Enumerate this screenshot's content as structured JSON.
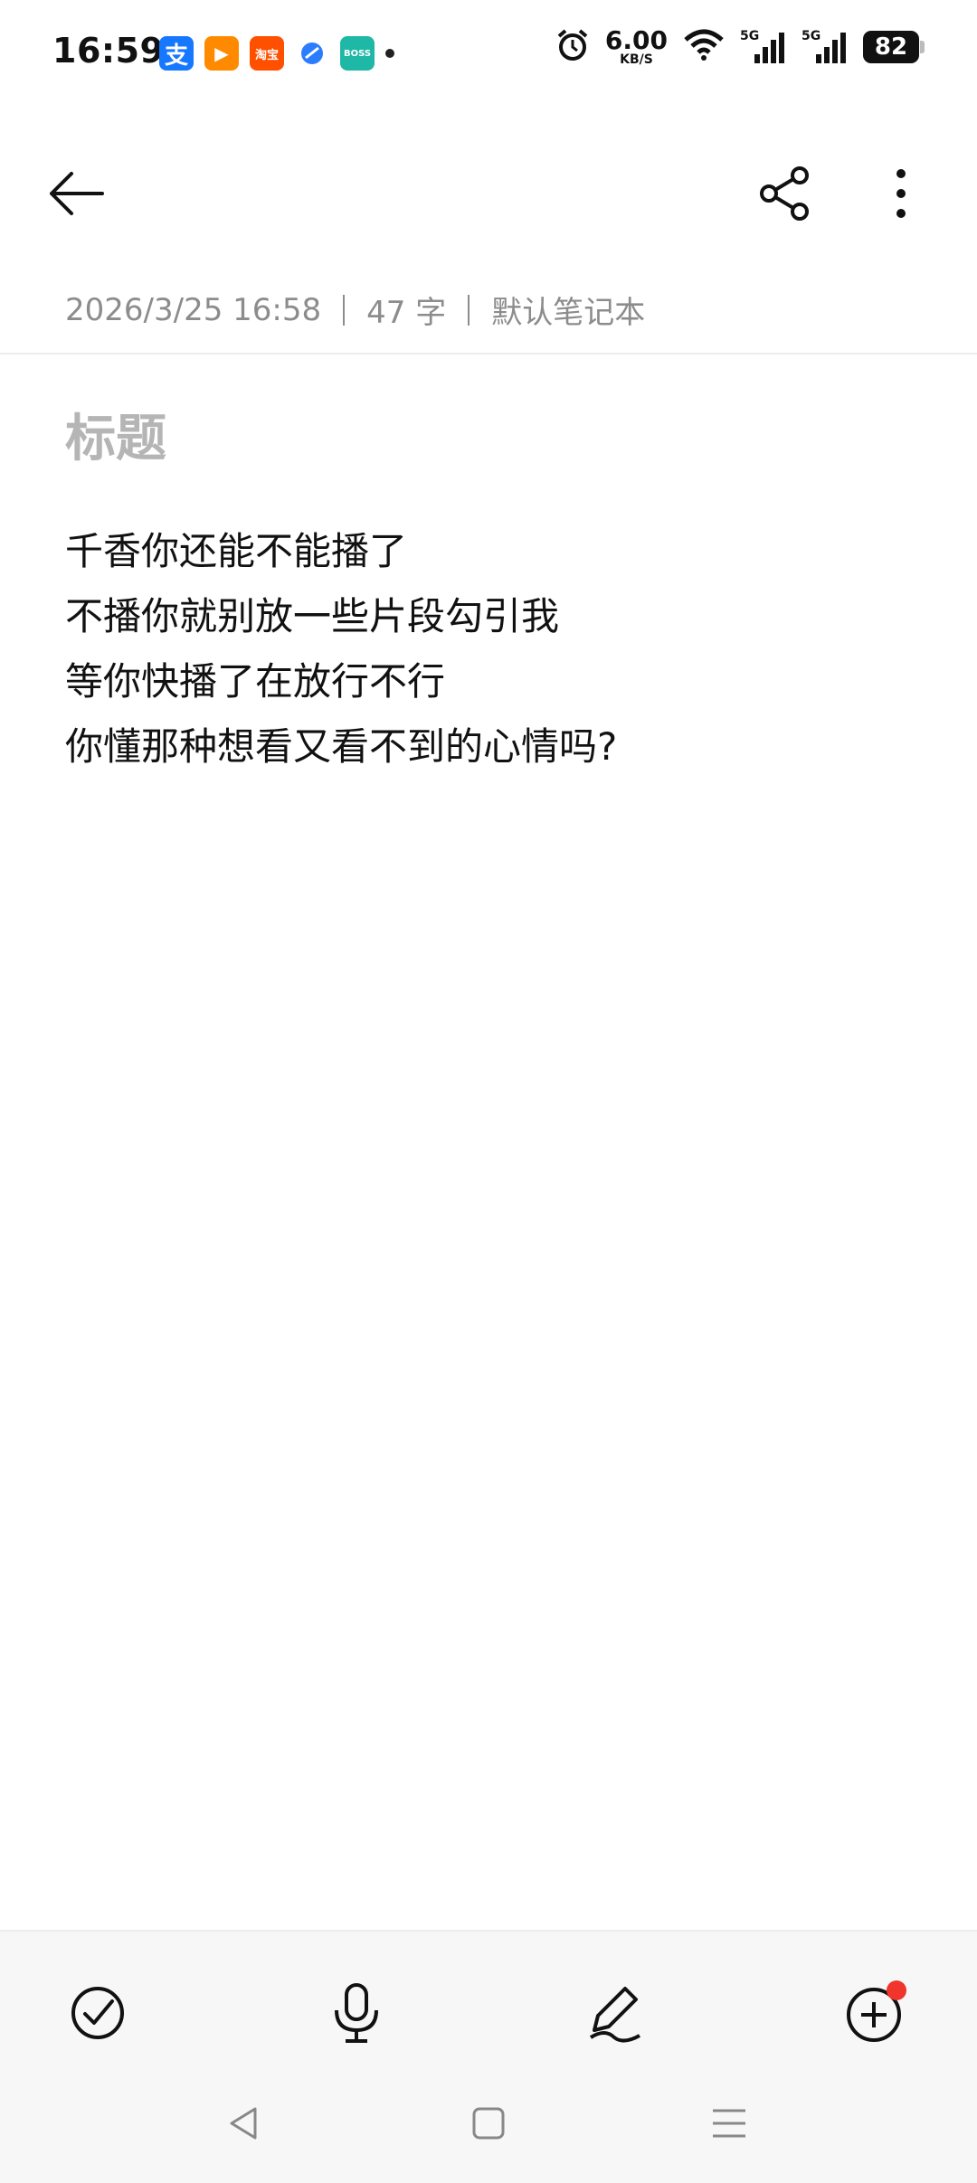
{
  "status_bar": {
    "time": "16:59",
    "network_speed_value": "6.00",
    "network_speed_unit": "KB/S",
    "battery": "82",
    "signal_label_1": "5G",
    "signal_label_2": "5G",
    "notifications": [
      {
        "name": "alipay-icon",
        "label": "支",
        "color": "#1677ff"
      },
      {
        "name": "video-app-icon",
        "label": "▶",
        "color": "#ff8a00"
      },
      {
        "name": "taobao-icon",
        "label": "淘宝",
        "color": "#ff5000"
      },
      {
        "name": "browser-app-icon",
        "label": "",
        "color": "#2b7cff"
      },
      {
        "name": "boss-zhipin-icon",
        "label": "BOSS",
        "color": "#1fb7a6"
      }
    ]
  },
  "note": {
    "meta": {
      "datetime": "2026/3/25 16:58",
      "word_count": "47 字",
      "notebook": "默认笔记本"
    },
    "title_placeholder": "标题",
    "lines": [
      "千香你还能不能播了",
      "不播你就别放一些片段勾引我",
      "等你快播了在放行不行",
      "你懂那种想看又看不到的心情吗?"
    ]
  },
  "accent": {
    "badge_color": "#f0352c"
  }
}
